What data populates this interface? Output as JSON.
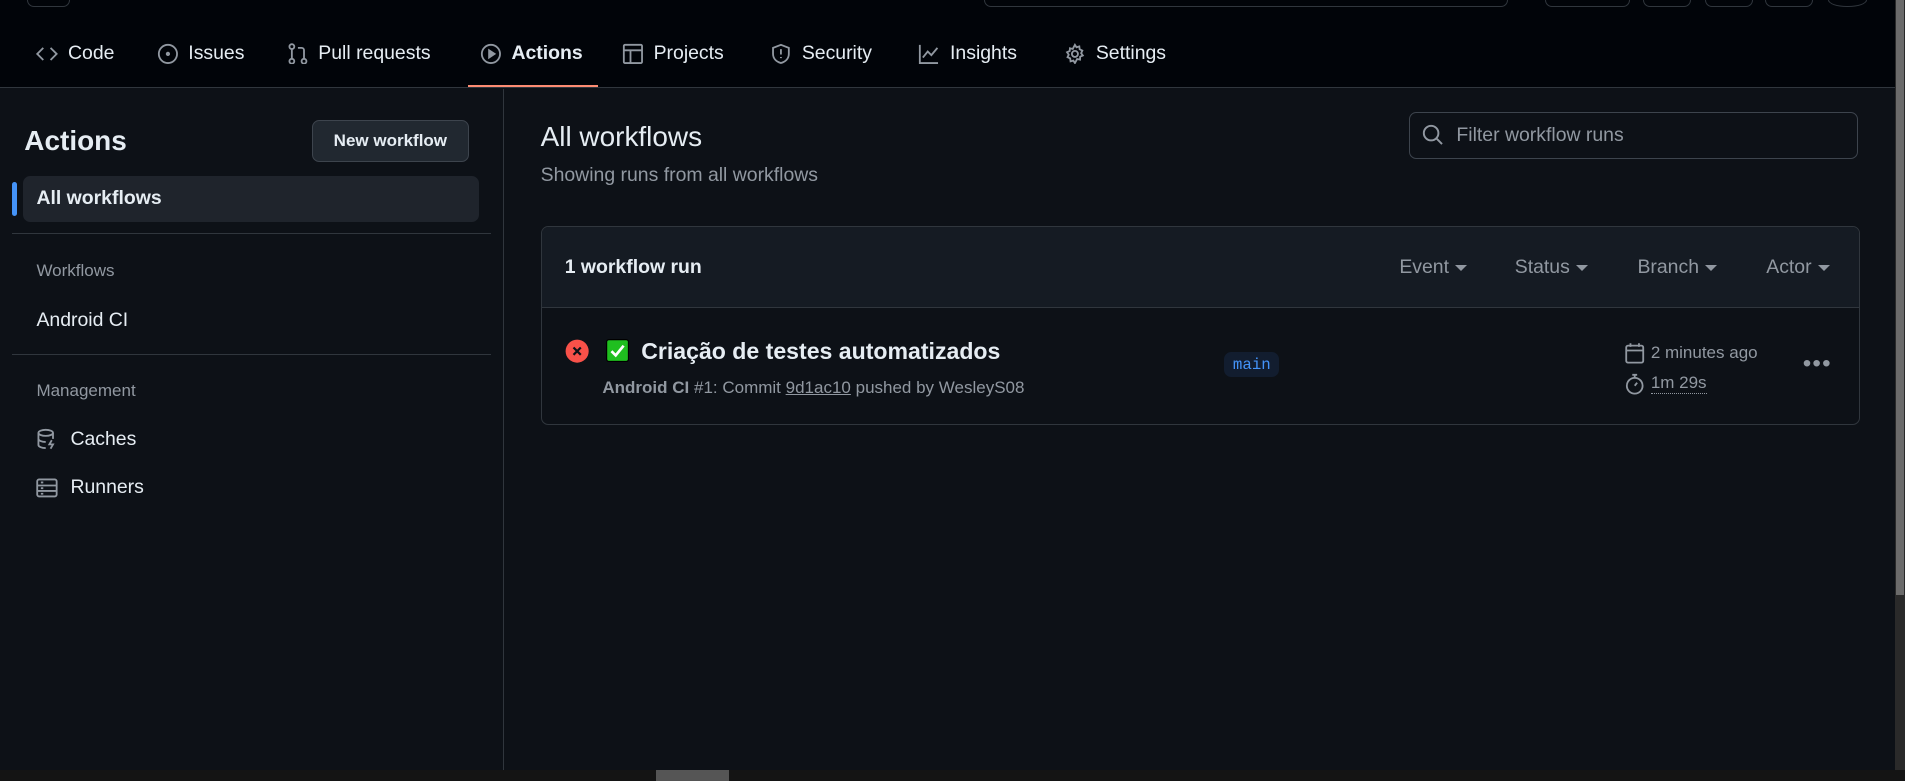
{
  "nav": {
    "tabs": [
      {
        "label": "Code",
        "icon": "code-icon"
      },
      {
        "label": "Issues",
        "icon": "issue-icon"
      },
      {
        "label": "Pull requests",
        "icon": "pull-request-icon"
      },
      {
        "label": "Actions",
        "icon": "play-icon",
        "active": true
      },
      {
        "label": "Projects",
        "icon": "table-icon"
      },
      {
        "label": "Security",
        "icon": "shield-icon"
      },
      {
        "label": "Insights",
        "icon": "graph-icon"
      },
      {
        "label": "Settings",
        "icon": "gear-icon"
      }
    ],
    "active_color": "#fd8c73"
  },
  "sidebar": {
    "title": "Actions",
    "new_workflow": "New workflow",
    "all_workflows": "All workflows",
    "workflows_label": "Workflows",
    "workflows": [
      "Android CI"
    ],
    "management_label": "Management",
    "management": [
      {
        "label": "Caches",
        "icon": "database-icon"
      },
      {
        "label": "Runners",
        "icon": "server-icon"
      }
    ]
  },
  "main": {
    "title": "All workflows",
    "subtitle": "Showing runs from all workflows",
    "filter_placeholder": "Filter workflow runs",
    "count": "1 workflow run",
    "filters": [
      "Event",
      "Status",
      "Branch",
      "Actor"
    ],
    "runs": [
      {
        "status": "failure",
        "title": "✅ Criação de testes automatizados",
        "workflow": "Android CI",
        "meta_prefix": "#1: Commit",
        "commit": "9d1ac10",
        "meta_suffix": "pushed by WesleyS08",
        "branch": "main",
        "when": "2 minutes ago",
        "duration": "1m 29s"
      }
    ]
  }
}
